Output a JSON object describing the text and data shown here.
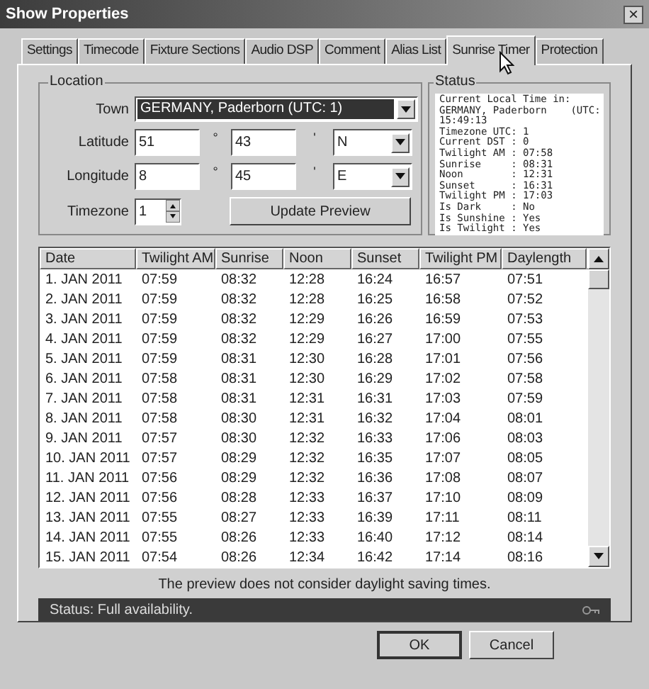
{
  "window": {
    "title": "Show Properties",
    "close": "×"
  },
  "tabs": [
    {
      "label": "Settings",
      "selected": false
    },
    {
      "label": "Timecode",
      "selected": false
    },
    {
      "label": "Fixture Sections",
      "selected": false
    },
    {
      "label": "Audio DSP",
      "selected": false
    },
    {
      "label": "Comment",
      "selected": false
    },
    {
      "label": "Alias List",
      "selected": false
    },
    {
      "label": "Sunrise Timer",
      "selected": true
    },
    {
      "label": "Protection",
      "selected": false
    }
  ],
  "location": {
    "title": "Location",
    "town": {
      "label": "Town",
      "value": "GERMANY, Paderborn  (UTC: 1)",
      "focused": true
    },
    "latitude": {
      "label": "Latitude",
      "degrees": "51",
      "degree_mark": "°",
      "minutes": "43",
      "minute_mark": "'",
      "direction": "N"
    },
    "longitude": {
      "label": "Longitude",
      "degrees": "8",
      "degree_mark": "°",
      "minutes": "45",
      "minute_mark": "'",
      "direction": "E"
    },
    "timezone": {
      "label": "Timezone",
      "value": "1"
    },
    "update_button": "Update Preview"
  },
  "status": {
    "title": "Status",
    "lines": [
      "Current Local Time in:",
      "GERMANY, Paderborn    (UTC:",
      "15:49:13",
      "Timezone UTC: 1",
      "Current DST : 0",
      "Twilight AM : 07:58",
      "Sunrise     : 08:31",
      "Noon        : 12:31",
      "Sunset      : 16:31",
      "Twilight PM : 17:03",
      "Is Dark     : No",
      "Is Sunshine : Yes",
      "Is Twilight : Yes"
    ]
  },
  "table": {
    "columns": [
      "Date",
      "Twilight AM",
      "Sunrise",
      "Noon",
      "Sunset",
      "Twilight PM",
      "Daylength"
    ],
    "rows": [
      [
        "1. JAN 2011",
        "07:59",
        "08:32",
        "12:28",
        "16:24",
        "16:57",
        "07:51"
      ],
      [
        "2. JAN 2011",
        "07:59",
        "08:32",
        "12:28",
        "16:25",
        "16:58",
        "07:52"
      ],
      [
        "3. JAN 2011",
        "07:59",
        "08:32",
        "12:29",
        "16:26",
        "16:59",
        "07:53"
      ],
      [
        "4. JAN 2011",
        "07:59",
        "08:32",
        "12:29",
        "16:27",
        "17:00",
        "07:55"
      ],
      [
        "5. JAN 2011",
        "07:59",
        "08:31",
        "12:30",
        "16:28",
        "17:01",
        "07:56"
      ],
      [
        "6. JAN 2011",
        "07:58",
        "08:31",
        "12:30",
        "16:29",
        "17:02",
        "07:58"
      ],
      [
        "7. JAN 2011",
        "07:58",
        "08:31",
        "12:31",
        "16:31",
        "17:03",
        "07:59"
      ],
      [
        "8. JAN 2011",
        "07:58",
        "08:30",
        "12:31",
        "16:32",
        "17:04",
        "08:01"
      ],
      [
        "9. JAN 2011",
        "07:57",
        "08:30",
        "12:32",
        "16:33",
        "17:06",
        "08:03"
      ],
      [
        "10. JAN 2011",
        "07:57",
        "08:29",
        "12:32",
        "16:35",
        "17:07",
        "08:05"
      ],
      [
        "11. JAN 2011",
        "07:56",
        "08:29",
        "12:32",
        "16:36",
        "17:08",
        "08:07"
      ],
      [
        "12. JAN 2011",
        "07:56",
        "08:28",
        "12:33",
        "16:37",
        "17:10",
        "08:09"
      ],
      [
        "13. JAN 2011",
        "07:55",
        "08:27",
        "12:33",
        "16:39",
        "17:11",
        "08:11"
      ],
      [
        "14. JAN 2011",
        "07:55",
        "08:26",
        "12:33",
        "16:40",
        "17:12",
        "08:14"
      ],
      [
        "15. JAN 2011",
        "07:54",
        "08:26",
        "12:34",
        "16:42",
        "17:14",
        "08:16"
      ]
    ]
  },
  "note": "The preview does not consider daylight saving times.",
  "status_bar": "Status: Full availability.",
  "buttons": [
    "OK",
    "Cancel"
  ]
}
